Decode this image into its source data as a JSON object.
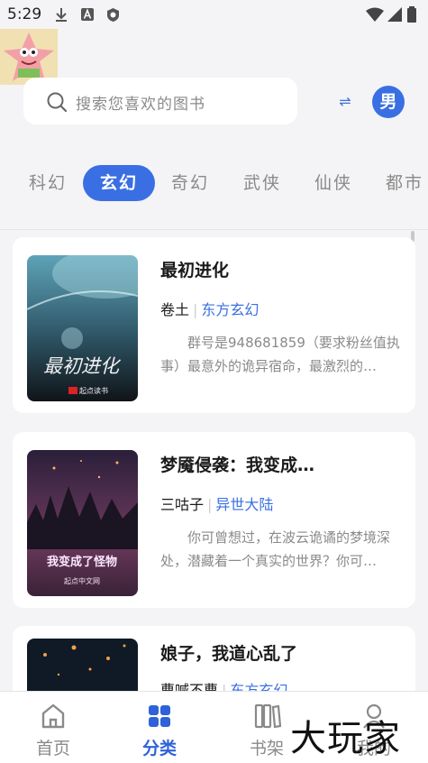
{
  "status_bar": {
    "time": "5:29"
  },
  "search": {
    "placeholder": "搜索您喜欢的图书"
  },
  "header": {
    "gender_label": "男",
    "swap_symbol": "⇌"
  },
  "tabs": [
    {
      "label": "科幻"
    },
    {
      "label": "玄幻"
    },
    {
      "label": "奇幻"
    },
    {
      "label": "武侠"
    },
    {
      "label": "仙侠"
    },
    {
      "label": "都市"
    }
  ],
  "books": [
    {
      "title": "最初进化",
      "author": "卷土",
      "genre": "东方玄幻",
      "intro": "群号是948681859（要求粉丝值执事）最意外的诡异宿命，最激烈的…",
      "cover_title": "最初进化",
      "cover_brand": "起点读书"
    },
    {
      "title": "梦魇侵袭：我变成…",
      "author": "三咕子",
      "genre": "异世大陆",
      "intro": "你可曾想过，在波云诡谲的梦境深处，潜藏着一个真实的世界？你可…",
      "cover_title": "我变成了怪物",
      "cover_brand": "起点中文网"
    },
    {
      "title": "娘子，我道心乱了",
      "author": "曹喊不曹",
      "genre": "东方玄幻"
    }
  ],
  "bottom_nav": [
    {
      "label": "首页"
    },
    {
      "label": "分类"
    },
    {
      "label": "书架"
    },
    {
      "label": "我的"
    }
  ],
  "watermark": "大玩家",
  "colors": {
    "accent": "#3a6fe3",
    "background": "#f4f4f6"
  }
}
